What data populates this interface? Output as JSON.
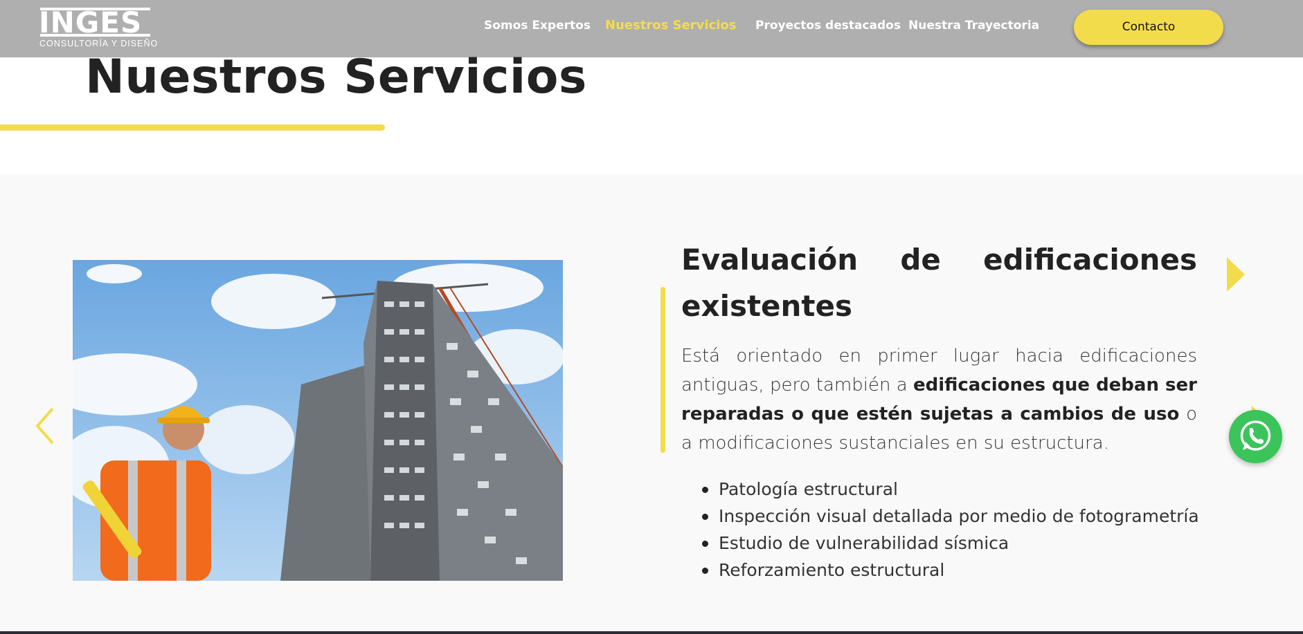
{
  "brand": {
    "logo_word": "INGES",
    "logo_sub": "CONSULTORÍA Y DISEÑO"
  },
  "nav": {
    "items": [
      {
        "label": "Somos Expertos"
      },
      {
        "label": "Nuestros Servicios",
        "active": true
      },
      {
        "label": "Proyectos destacados"
      },
      {
        "label": "Nuestra Trayectoria"
      }
    ],
    "contact_label": "Contacto"
  },
  "section": {
    "title": "Nuestros Servicios"
  },
  "slide": {
    "heading_words": [
      "Evaluación",
      "de",
      "edificaciones"
    ],
    "heading_line2": "existentes",
    "para_1": "Está orientado en primer lugar hacia edificaciones antiguas, pero también a ",
    "para_bold": "edificaciones que deban ser reparadas o que estén sujetas a cambios de uso",
    "para_2": " o a modificaciones sustanciales en su estructura.",
    "list": [
      "Patología estructural",
      "Inspección visual detallada por medio de fotogrametría",
      "Estudio de vulnerabilidad sísmica",
      "Reforzamiento estructural"
    ]
  },
  "icons": {
    "prev": "chevron-left-icon",
    "next": "triangle-right-icon",
    "whatsapp": "whatsapp-icon"
  },
  "colors": {
    "accent": "#f3dc4c",
    "nav_bg": "#afafaf",
    "whatsapp": "#3ac45a",
    "section_bg": "#f9f9f9"
  }
}
